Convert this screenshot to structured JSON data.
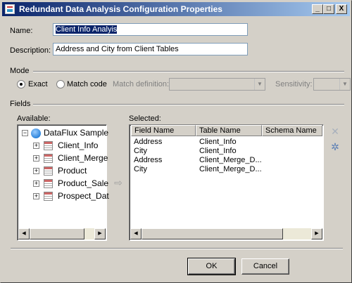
{
  "window": {
    "title": "Redundant Data Analysis Configuration Properties",
    "min_label": "_",
    "max_label": "□",
    "close_label": "X"
  },
  "form": {
    "name_label": "Name:",
    "name_value": "Client Info Analyis",
    "description_label": "Description:",
    "description_value": "Address and City from Client Tables"
  },
  "mode": {
    "section_label": "Mode",
    "exact_label": "Exact",
    "match_code_label": "Match code",
    "match_definition_label": "Match definition:",
    "match_definition_value": "",
    "sensitivity_label": "Sensitivity:",
    "sensitivity_value": "",
    "selected": "Exact"
  },
  "fields": {
    "section_label": "Fields",
    "available_label": "Available:",
    "selected_label": "Selected:",
    "tree_root": "DataFlux Sample",
    "tree_items": [
      "Client_Info",
      "Client_Merge",
      "Product",
      "Product_Sale",
      "Prospect_Dat"
    ],
    "columns": [
      "Field Name",
      "Table Name",
      "Schema Name"
    ],
    "rows": [
      {
        "field": "Address",
        "table": "Client_Info",
        "schema": ""
      },
      {
        "field": "City",
        "table": "Client_Info",
        "schema": ""
      },
      {
        "field": "Address",
        "table": "Client_Merge_D...",
        "schema": ""
      },
      {
        "field": "City",
        "table": "Client_Merge_D...",
        "schema": ""
      }
    ]
  },
  "icons": {
    "move_right": "arrow-right-icon",
    "remove": "delete-x-icon",
    "remove_all": "remove-all-icon"
  },
  "buttons": {
    "ok_label": "OK",
    "cancel_label": "Cancel"
  }
}
